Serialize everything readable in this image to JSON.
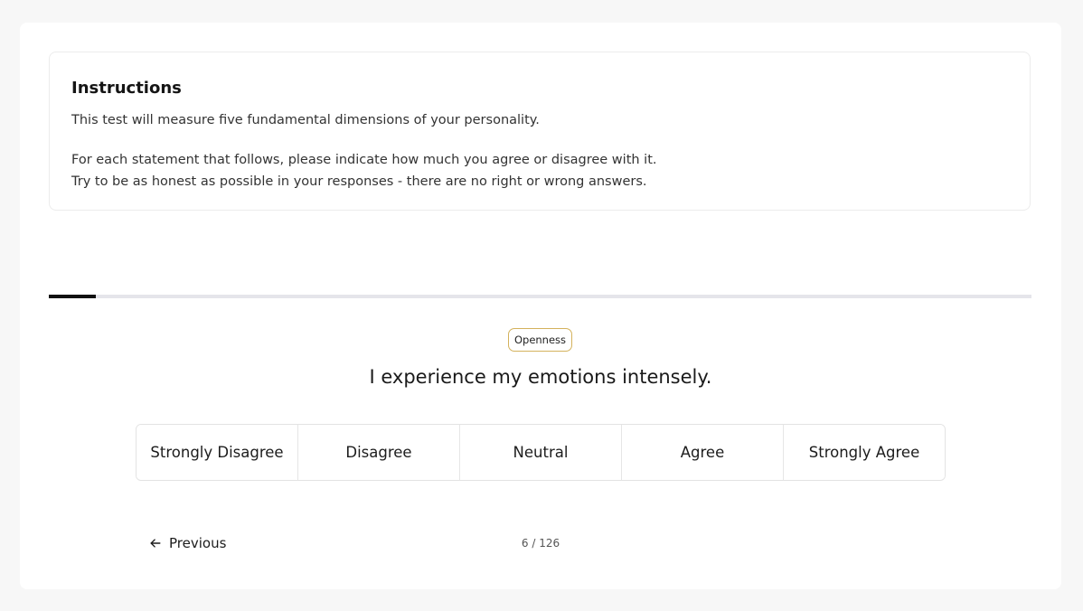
{
  "instructions": {
    "title": "Instructions",
    "paragraph1": "This test will measure five fundamental dimensions of your personality.",
    "paragraph2_line1": "For each statement that follows, please indicate how much you agree or disagree with it.",
    "paragraph2_line2": "Try to be as honest as possible in your responses - there are no right or wrong answers."
  },
  "progress": {
    "current": 6,
    "total": 126,
    "fraction": 0.048
  },
  "question": {
    "category": "Openness",
    "text": "I experience my emotions intensely."
  },
  "options": [
    {
      "label": "Strongly Disagree"
    },
    {
      "label": "Disagree"
    },
    {
      "label": "Neutral"
    },
    {
      "label": "Agree"
    },
    {
      "label": "Strongly Agree"
    }
  ],
  "navigation": {
    "previous_label": "Previous",
    "counter": "6 / 126"
  },
  "colors": {
    "accent": "#111111",
    "tag_border": "#d4b25c",
    "track": "#e5e5ea"
  }
}
